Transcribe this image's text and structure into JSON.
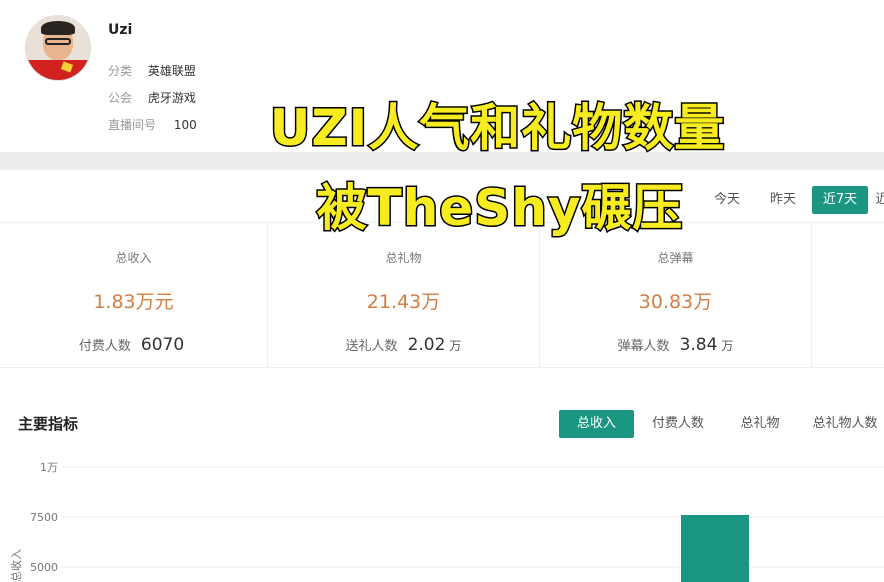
{
  "profile": {
    "name": "Uzi",
    "category_label": "分类",
    "category_value": "英雄联盟",
    "guild_label": "公会",
    "guild_value": "虎牙游戏",
    "room_label": "直播间号",
    "room_value": "100"
  },
  "filters": {
    "today": "今天",
    "yesterday": "昨天",
    "last7": "近7天",
    "more": "近"
  },
  "stats": [
    {
      "label": "总收入",
      "value": "1.83万元",
      "sub_label": "付费人数",
      "sub_value": "6070",
      "sub_unit": ""
    },
    {
      "label": "总礼物",
      "value": "21.43万",
      "sub_label": "送礼人数",
      "sub_value": "2.02",
      "sub_unit": "万"
    },
    {
      "label": "总弹幕",
      "value": "30.83万",
      "sub_label": "弹幕人数",
      "sub_value": "3.84",
      "sub_unit": "万"
    }
  ],
  "metrics": {
    "title": "主要指标",
    "tabs": [
      "总收入",
      "付费人数",
      "总礼物",
      "总礼物人数"
    ]
  },
  "chart_data": {
    "type": "bar",
    "y_ticks": [
      "1万",
      "7500",
      "5000"
    ],
    "ylabel": "总收入",
    "ylim": [
      0,
      10000
    ],
    "visible_bars": [
      {
        "value": 7600
      }
    ],
    "colors": {
      "bar": "#1a9683"
    }
  },
  "overlay": {
    "line1": "UZI人气和礼物数量",
    "line2": "被TheShy碾压"
  },
  "colors": {
    "accent": "#1a9683",
    "value": "#d27e42",
    "overlay_text": "#f7ec1f"
  }
}
